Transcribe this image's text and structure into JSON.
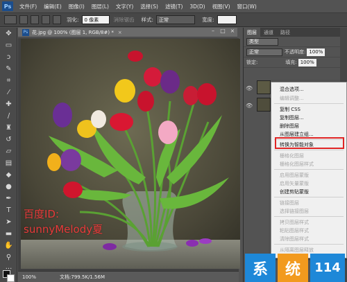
{
  "menubar": {
    "logo": "Ps",
    "items": [
      "文件(F)",
      "编辑(E)",
      "图像(I)",
      "图层(L)",
      "文字(Y)",
      "选择(S)",
      "滤镜(T)",
      "3D(D)",
      "视图(V)",
      "窗口(W)"
    ]
  },
  "optionsbar": {
    "feather_label": "羽化:",
    "feather_value": "0 像素",
    "antialias_label": "消除锯齿",
    "style_label": "样式:",
    "style_value": "正常",
    "width_label": "宽度:"
  },
  "document": {
    "tab_title": "花.jpg @ 100% (图层 1, RGB/8#) *",
    "zoom": "100%",
    "doc_size": "文档:799.5K/1.56M"
  },
  "watermark": {
    "line1": "百度ID:",
    "line2": "sunnyMelody夏"
  },
  "layers_panel": {
    "tabs": [
      "图层",
      "通道",
      "路径"
    ],
    "filter_label": "类型",
    "blend_mode": "正常",
    "opacity_label": "不透明度:",
    "opacity_value": "100%",
    "lock_label": "锁定:",
    "fill_label": "填充:",
    "fill_value": "100%"
  },
  "context_menu": {
    "items": [
      {
        "label": "混合选项...",
        "enabled": true
      },
      {
        "label": "编辑调整...",
        "enabled": false
      },
      {
        "label": "复制 CSS",
        "enabled": true
      },
      {
        "label": "复制图层...",
        "enabled": true
      },
      {
        "label": "删除图层",
        "enabled": true
      },
      {
        "label": "从图层建立组...",
        "enabled": true
      },
      {
        "label": "转换为智能对象",
        "enabled": true,
        "highlighted": true
      },
      {
        "label": "栅格化图层",
        "enabled": false
      },
      {
        "label": "栅格化图层样式",
        "enabled": false
      },
      {
        "label": "启用图层蒙版",
        "enabled": false
      },
      {
        "label": "启用矢量蒙版",
        "enabled": false
      },
      {
        "label": "创建剪贴蒙版",
        "enabled": true
      },
      {
        "label": "链接图层",
        "enabled": false
      },
      {
        "label": "选择链接图层",
        "enabled": false
      },
      {
        "label": "拷贝图层样式",
        "enabled": false
      },
      {
        "label": "粘贴图层样式",
        "enabled": false
      },
      {
        "label": "清除图层样式",
        "enabled": false
      },
      {
        "label": "从隔离图层释放",
        "enabled": false
      }
    ]
  },
  "site_badge": {
    "chars": [
      "系",
      "统",
      "114"
    ],
    "colors": [
      "#1e88d8",
      "#f29a1e",
      "#1e88d8"
    ]
  },
  "colors": {
    "highlight_border": "#e02424",
    "watermark": "#e83a3a"
  }
}
